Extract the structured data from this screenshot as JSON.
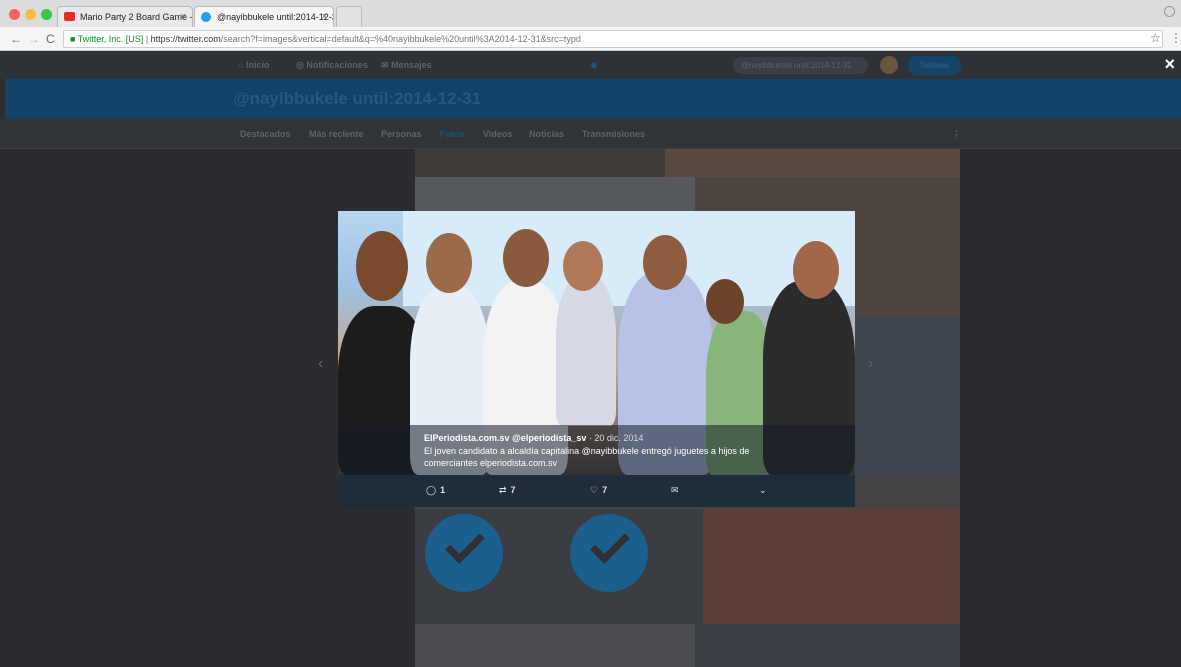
{
  "browser": {
    "tabs": [
      {
        "title": "Mario Party 2 Board Game - ",
        "active": false
      },
      {
        "title": "@nayibbukele until:2014-12-3",
        "active": true
      }
    ],
    "close_glyph": "×",
    "secure_label": "Twitter, Inc. [US]",
    "url_host": "https://twitter.com",
    "url_path": "/search?f=images&vertical=default&q=%40nayibbukele%20until%3A2014-12-31&src=typd"
  },
  "twitter_nav": {
    "items": [
      "Inicio",
      "Notificaciones",
      "Mensajes"
    ],
    "search_value": "@nayibbukele until:2014-12-31",
    "tweet_button": "Twittear"
  },
  "search_heading": "@nayibbukele until:2014-12-31",
  "filters": [
    "Destacados",
    "Más reciente",
    "Personas",
    "Fotos",
    "Videos",
    "Noticias",
    "Transmisiones"
  ],
  "active_filter": "Fotos",
  "modal": {
    "close": "×",
    "author": "ElPeriodista.com.sv @elperiodista_sv",
    "date": "· 20 dic. 2014",
    "text_line1": "El joven candidato a alcaldía capitalina @nayibbukele entregó juguetes a hijos de",
    "text_line2": "comerciantes elperiodista.com.sv",
    "actions": {
      "replies": "1",
      "retweets": "7",
      "likes": "7"
    }
  },
  "icons": {
    "reply": "reply-icon",
    "retweet": "retweet-icon",
    "like": "heart-icon",
    "dm": "envelope-icon",
    "more": "chevron-down-icon"
  },
  "colors": {
    "twitter_blue": "#1da1f2",
    "overlay": "#2b2d30"
  }
}
